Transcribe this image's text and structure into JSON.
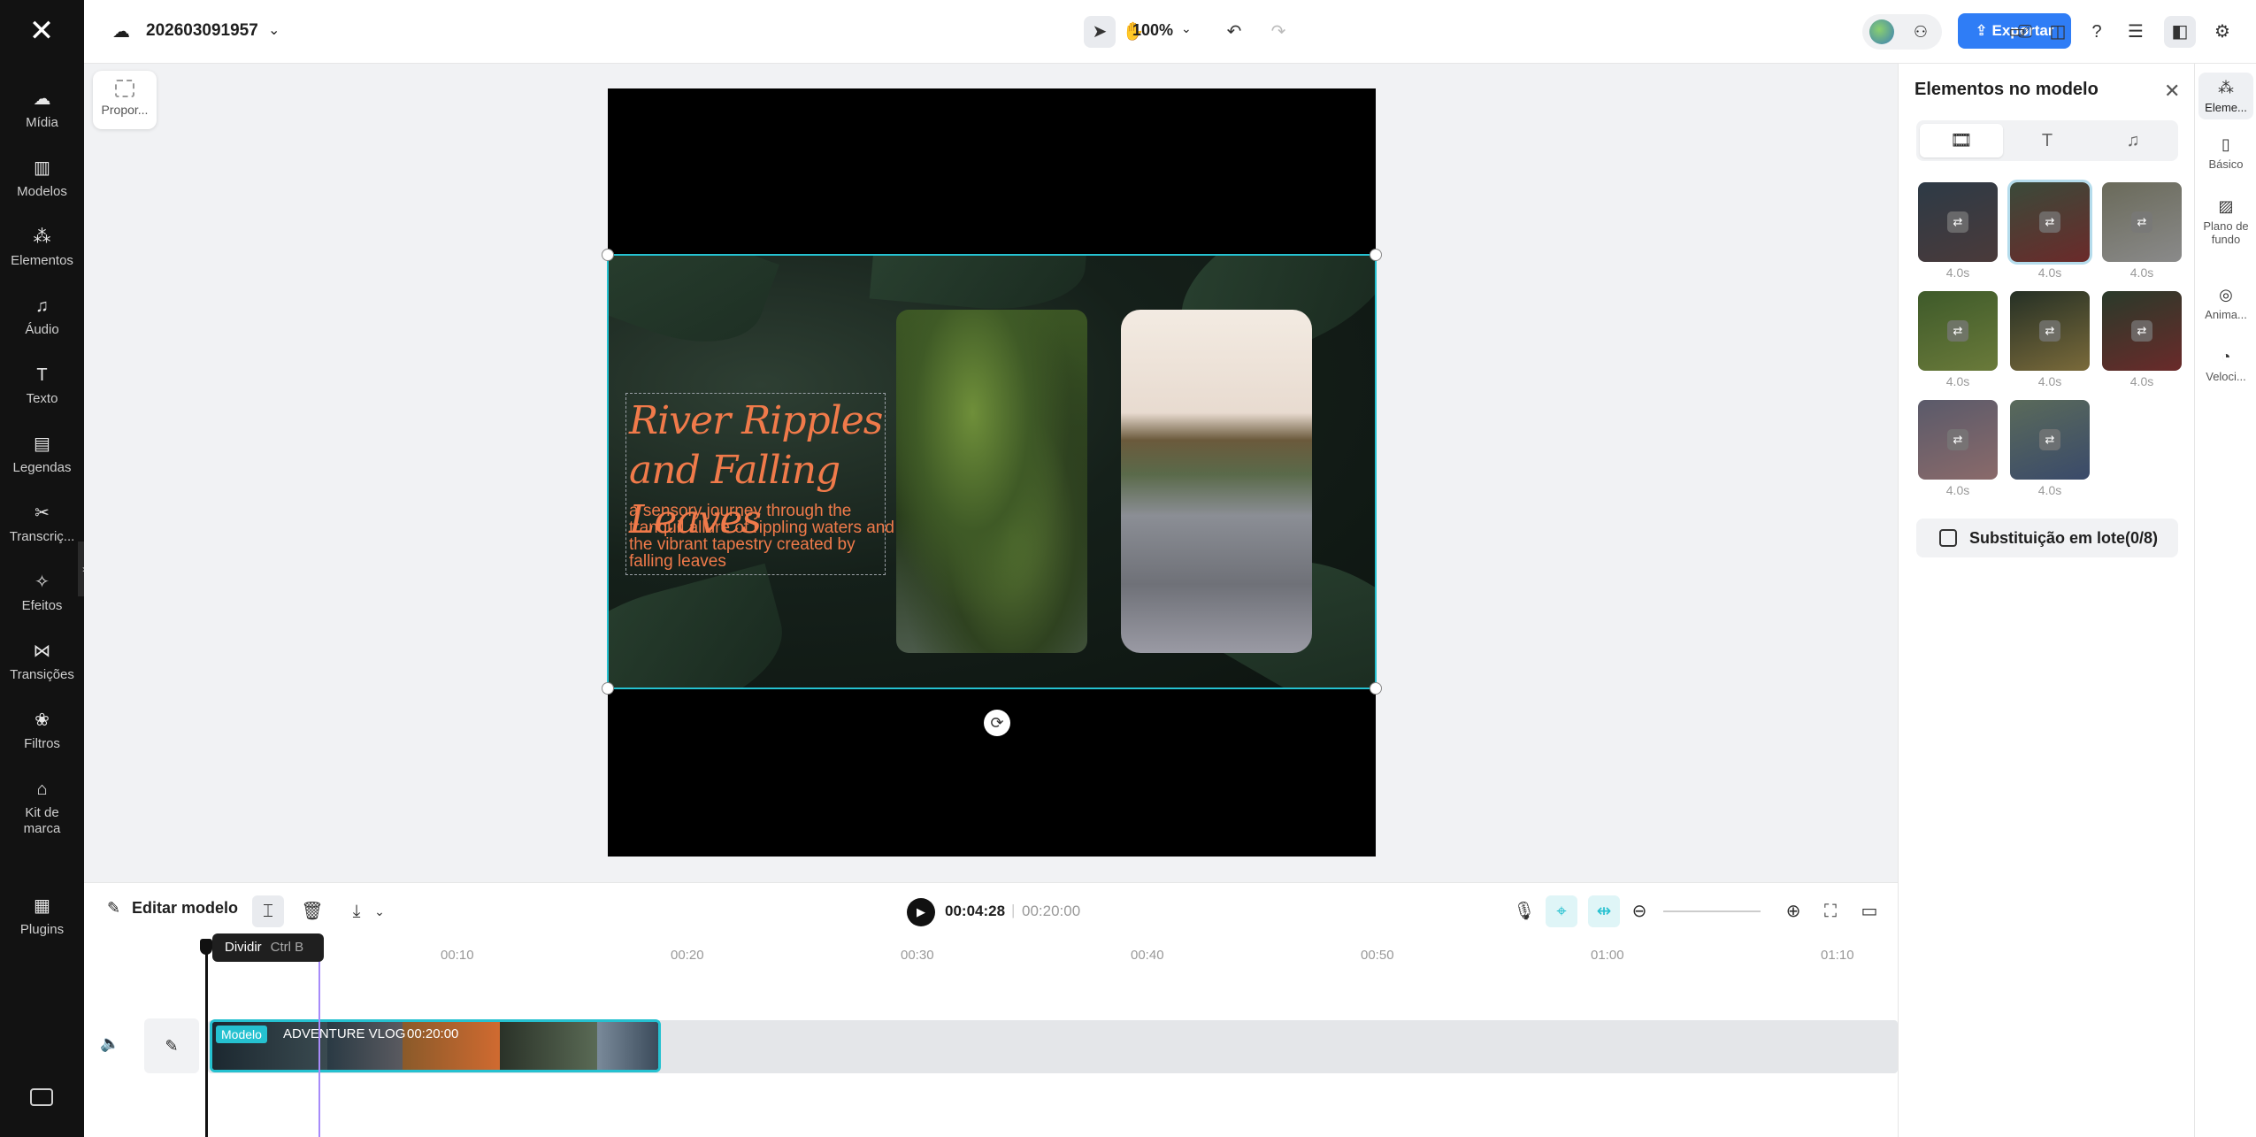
{
  "app": {
    "project_name": "202603091957",
    "zoom": "100%",
    "export_label": "Exportar",
    "accent": "#2f7df6",
    "selection_color": "#25c1d0"
  },
  "left_nav": [
    {
      "label": "Mídia",
      "icon": "cloud-upload-icon",
      "glyph": "☁"
    },
    {
      "label": "Modelos",
      "icon": "templates-icon",
      "glyph": "▥"
    },
    {
      "label": "Elementos",
      "icon": "elements-icon",
      "glyph": "⁂"
    },
    {
      "label": "Áudio",
      "icon": "music-note-icon",
      "glyph": "♫"
    },
    {
      "label": "Texto",
      "icon": "text-icon",
      "glyph": "T"
    },
    {
      "label": "Legendas",
      "icon": "captions-icon",
      "glyph": "▤"
    },
    {
      "label": "Transcriç...",
      "icon": "transcript-icon",
      "glyph": "✂"
    },
    {
      "label": "Efeitos",
      "icon": "effects-icon",
      "glyph": "✧"
    },
    {
      "label": "Transições",
      "icon": "transitions-icon",
      "glyph": "⋈"
    },
    {
      "label": "Filtros",
      "icon": "filters-icon",
      "glyph": "❀"
    },
    {
      "label": "Kit de marca",
      "icon": "brand-kit-icon",
      "glyph": "⌂"
    },
    {
      "label": "Plugins",
      "icon": "plugins-icon",
      "glyph": "▦"
    }
  ],
  "stage": {
    "ratio_label": "Propor...",
    "title": "River Ripples and Falling Leaves",
    "subtitle": "a sensory journey through the tranquil allure of rippling waters and the vibrant tapestry created by falling leaves"
  },
  "right_panel": {
    "title": "Elementos no modelo",
    "thumbs": [
      {
        "duration": "4.0s",
        "selected": false,
        "colors": [
          "#2d3a46",
          "#4a3a3a"
        ]
      },
      {
        "duration": "4.0s",
        "selected": true,
        "colors": [
          "#3a4a3a",
          "#6b2a2a"
        ]
      },
      {
        "duration": "4.0s",
        "selected": false,
        "colors": [
          "#6a6a5a",
          "#8a8a8a"
        ]
      },
      {
        "duration": "4.0s",
        "selected": false,
        "colors": [
          "#3e5a2a",
          "#6a7a3a"
        ]
      },
      {
        "duration": "4.0s",
        "selected": false,
        "colors": [
          "#253025",
          "#7a6a3a"
        ]
      },
      {
        "duration": "4.0s",
        "selected": false,
        "colors": [
          "#2a3a2a",
          "#6a2a2a"
        ]
      },
      {
        "duration": "4.0s",
        "selected": false,
        "colors": [
          "#5a5a6a",
          "#8a6a6a"
        ]
      },
      {
        "duration": "4.0s",
        "selected": false,
        "colors": [
          "#5a6a5a",
          "#3a4a6a"
        ]
      }
    ],
    "batch_label": "Substituição em lote(0/8)"
  },
  "right_tabs": [
    {
      "label": "Eleme...",
      "glyph": "⁂",
      "icon": "elements-tab-icon",
      "active": true
    },
    {
      "label": "Básico",
      "glyph": "▯",
      "icon": "basic-icon",
      "active": false
    },
    {
      "label": "Plano de fundo",
      "glyph": "▨",
      "icon": "background-icon",
      "active": false
    },
    {
      "label": "Anima...",
      "glyph": "◎",
      "icon": "animation-icon",
      "active": false
    },
    {
      "label": "Veloci...",
      "glyph": "◔",
      "icon": "speed-icon",
      "active": false
    }
  ],
  "timeline": {
    "edit_label": "Editar modelo",
    "current_time": "00:04:28",
    "total_time": "00:20:00",
    "tooltip_label": "Dividir",
    "tooltip_shortcut": "Ctrl B",
    "ticks": [
      "00:10",
      "00:20",
      "00:30",
      "00:40",
      "00:50",
      "01:00",
      "01:10"
    ],
    "clip": {
      "tag": "Modelo",
      "name": "ADVENTURE VLOG",
      "duration": "00:20:00"
    }
  }
}
